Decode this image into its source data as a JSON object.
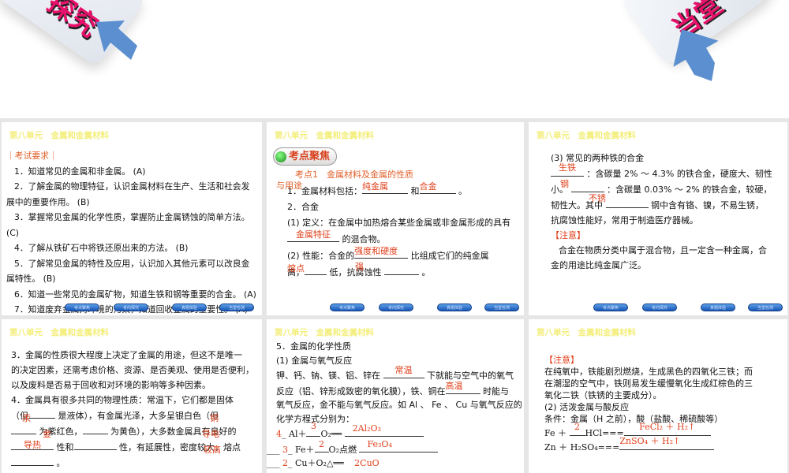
{
  "banner": {
    "left_text": "探究",
    "right_text": "当堂"
  },
  "unit_title": "第八单元　金属和金属材料",
  "nav_buttons": [
    "考点聚焦",
    "考向探究",
    "真题体验",
    "当堂检测"
  ],
  "slide1": {
    "heading": "｜考试要求｜",
    "items": [
      "1．知道常见的金属和非金属。 (A)",
      "2．了解金属的物理特征，认识金属材料在生产、生活和社会发",
      "展中的重要作用。 (B)",
      "3．掌握常见金属的化学性质，掌握防止金属锈蚀的简单方法。",
      "(C)",
      "4．了解从铁矿石中将铁还原出来的方法。 (B)",
      "5．了解常见金属的特性及应用，认识加入其他元素可以改良金",
      "属特性。 (B)",
      "6．知道一些常见的金属矿物，知道生铁和钢等重要的合金。 (A)",
      "7．知道废弃金属对环境的污染，知道回收金属的重要性。 (A)"
    ]
  },
  "slide2": {
    "badge": "考点聚焦",
    "topic": "考点1　金属材料及金属的性质",
    "topic2": "与用途",
    "l1a": "1．金属材料包括：",
    "a1": "纯金属",
    "l1b": "和",
    "a2": "合金",
    "l1c": "。",
    "l2": "2．合金",
    "l3": "(1) 定义：在金属中加热熔合某些金属或非金属形成的具有",
    "a3": "金属特征",
    "l4": "的混合物。",
    "l5a": "(2) 性能：合金的",
    "a4": "强度和硬度",
    "l5b": "比组成它们的纯金属",
    "l6a": "高，",
    "a5": "熔点",
    "l6b": "低，抗腐蚀性",
    "a6": "强",
    "l6c": "。"
  },
  "slide3": {
    "l1": "(3) 常见的两种铁的合金",
    "a1": "生铁",
    "l2": "：含碳量 2% ～ 4.3% 的铁合金，硬度大、韧性",
    "l3a": "小。",
    "a2": "钢",
    "l3b": "：含碳量 0.03% ～ 2% 的铁合金，较硬，",
    "l4a": "韧性大。其中",
    "a3": "不锈",
    "l4b": "钢中含有铬、镍，不易生锈，",
    "l5": "抗腐蚀性能好，常用于制造医疗器械。",
    "note": "【注意】",
    "n1": "合金在物质分类中属于混合物，且一定含一种金属，合",
    "n2": "金的用途比纯金属广泛。"
  },
  "slide4": {
    "l1": "3．金属的性质很大程度上决定了金属的用途，但这不是唯一",
    "l2": "的决定因素，还需考虑价格、资源、是否美观、使用是否便利，",
    "l3": "以及废料是否易于回收和对环境的影响等多种因素。",
    "l4": "4．金属具有很多共同的物理性质：常温下，它们都是固体",
    "l5a": "（但",
    "a1": "汞",
    "l5b": "是液体），有金属光泽，大多呈银白色（但",
    "a2": "铜",
    "l6a": "为紫红色，",
    "a3": "金",
    "l6b": "为黄色），大多数金属具有良好的",
    "a4": "导热",
    "l7a": "性和",
    "a5": "导电",
    "l7b": "性，有延展性，密度较大，熔点",
    "a6": "较高",
    "l8": "。"
  },
  "slide5": {
    "l1": "5．金属的化学性质",
    "l2": "(1) 金属与氧气反应",
    "l3a": "钾、钙、钠、镁、铝、锌在",
    "a1": "常温",
    "l3b": "下就能与空气中的氧气",
    "l4a": "反应（铝、锌形成致密的氧化膜），铁、铜在",
    "a2": "高温",
    "l4b": "时能与",
    "l5": "氧气反应，金不能与氧气反应。如 Al 、 Fe 、 Cu 与氧气反应的",
    "l6": "化学方程式分别为：",
    "eq1": {
      "c1": "4",
      "m": "Al＋",
      "c2": "3",
      "o": "O₂══",
      "p": "2Al₂O₃"
    },
    "eq2": {
      "c1": "3",
      "m": "Fe＋",
      "c2": "2",
      "o": "O₂点燃",
      "p": "Fe₃O₄"
    },
    "eq3": {
      "c1": "2",
      "m": "Cu＋O₂",
      "o": "△══",
      "p": "2CuO"
    }
  },
  "slide6": {
    "note": "【注意】",
    "n1": "在纯氧中，铁能剧烈燃烧，生成黑色的四氧化三铁；而",
    "n2": "在潮湿的空气中，铁则易发生缓慢氧化生成红棕色的三",
    "n3": "氧化二铁（铁锈的主要成分）。",
    "l1": "(2) 活泼金属与酸反应",
    "l2": "条件：金属（H 之前），酸（盐酸、稀硫酸等）",
    "e1a": "Fe ＋",
    "a1": "2",
    "e1b": "HCl===",
    "a2": "FeCl₂ ＋ H₂↑",
    "e2a": "Zn ＋ H₂SO₄===",
    "a3": "ZnSO₄ ＋ H₂↑"
  }
}
